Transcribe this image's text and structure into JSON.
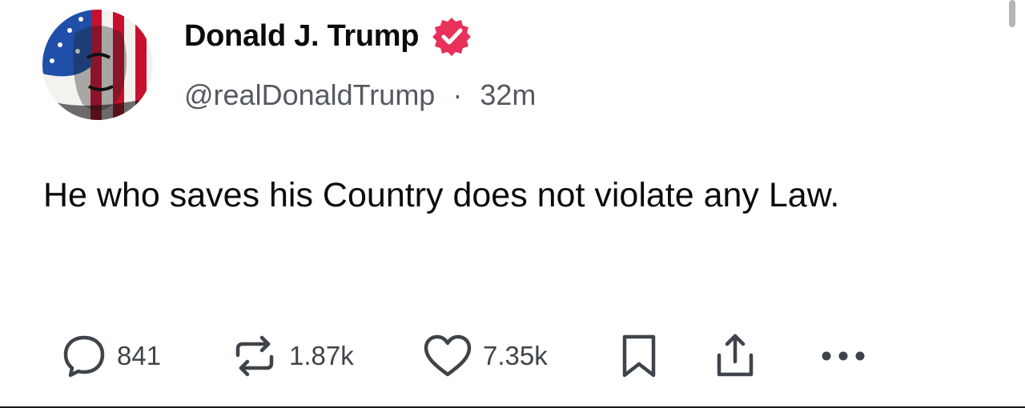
{
  "author": {
    "display_name": "Donald J. Trump",
    "handle": "@realDonaldTrump",
    "separator": "·",
    "time_ago": "32m",
    "avatar_icon": "avatar-flag-portrait",
    "verified_icon": "verified-badge-icon"
  },
  "post": {
    "text": "He who saves his Country does not violate any Law."
  },
  "actions": {
    "replies": "841",
    "reposts": "1.87k",
    "likes": "7.35k"
  },
  "colors": {
    "verified": "#e8315a",
    "text_primary": "#0b0b0b",
    "text_secondary": "#555a60",
    "icon": "#3f444a",
    "flag_red": "#c8102e",
    "flag_blue": "#1f4fa8"
  }
}
